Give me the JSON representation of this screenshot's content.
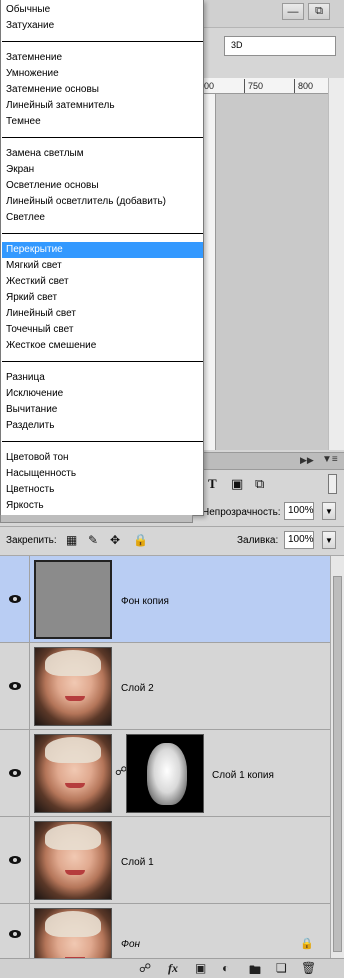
{
  "toolbar": {
    "minimize_icon": "minimize-icon",
    "restore_icon": "restore-icon",
    "workspace_select": "3D"
  },
  "ruler": {
    "ticks": [
      "00",
      "750",
      "800"
    ]
  },
  "blend_modes": {
    "selected": "Перекрытие",
    "groups": [
      [
        "Обычные",
        "Затухание"
      ],
      [
        "Затемнение",
        "Умножение",
        "Затемнение основы",
        "Линейный затемнитель",
        "Темнее"
      ],
      [
        "Замена светлым",
        "Экран",
        "Осветление основы",
        "Линейный осветлитель (добавить)",
        "Светлее"
      ],
      [
        "Перекрытие",
        "Мягкий свет",
        "Жесткий свет",
        "Яркий свет",
        "Линейный свет",
        "Точечный свет",
        "Жесткое смешение"
      ],
      [
        "Разница",
        "Исключение",
        "Вычитание",
        "Разделить"
      ],
      [
        "Цветовой тон",
        "Насыщенность",
        "Цветность",
        "Яркость"
      ]
    ]
  },
  "layers_panel": {
    "opacity_label": "Непрозрачность:",
    "opacity_value": "100%",
    "lock_label": "Закрепить:",
    "fill_label": "Заливка:",
    "fill_value": "100%",
    "layers": [
      {
        "name": "Фон копия",
        "selected": true,
        "thumb": "gray"
      },
      {
        "name": "Слой 2",
        "selected": false,
        "thumb": "face"
      },
      {
        "name": "Слой 1 копия",
        "selected": false,
        "thumb": "face",
        "mask": true
      },
      {
        "name": "Слой 1",
        "selected": false,
        "thumb": "face"
      },
      {
        "name": "Фон",
        "selected": false,
        "thumb": "face",
        "locked": true
      }
    ]
  },
  "colors": {
    "selection": "#b9cdf3",
    "menu_highlight": "#3399ff"
  }
}
